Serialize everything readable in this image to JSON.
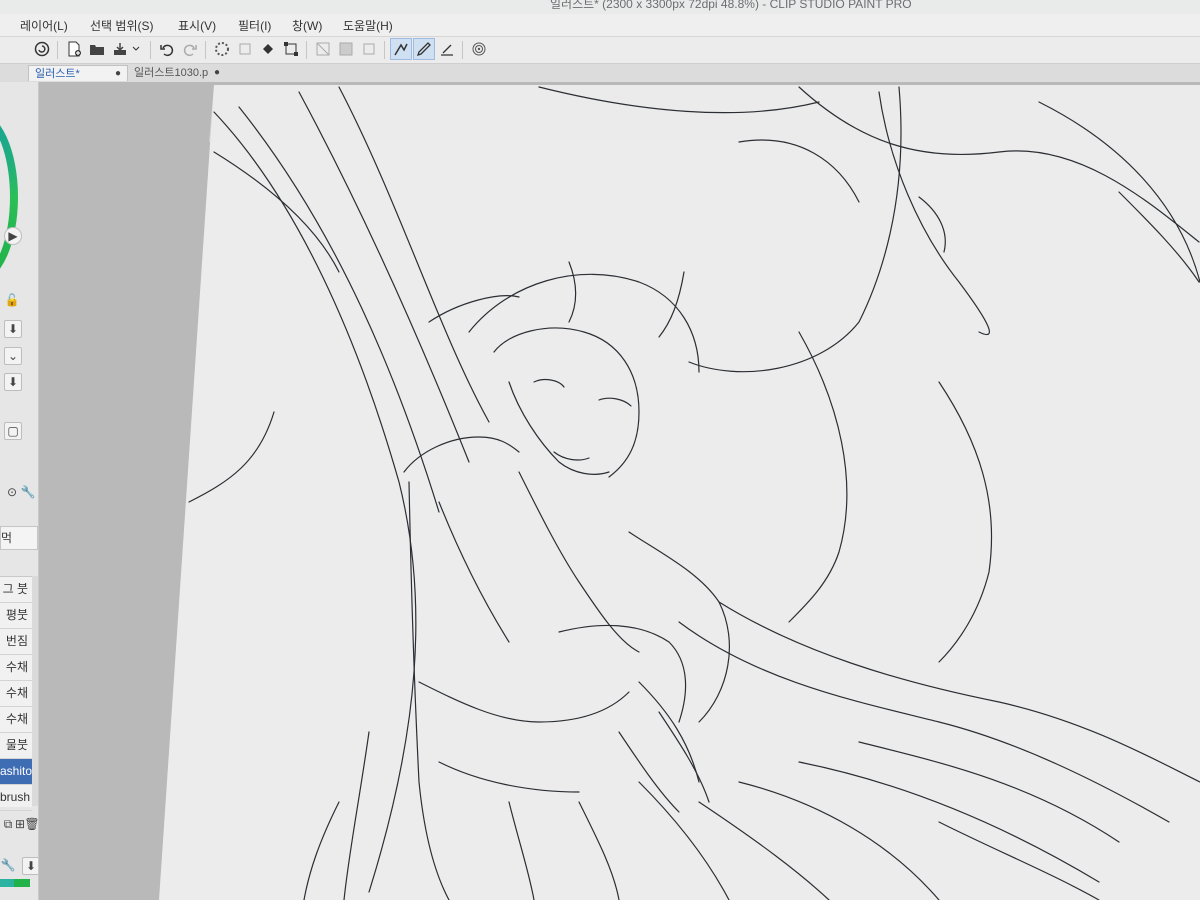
{
  "window": {
    "title": "일러스트* (2300 x 3300px 72dpi 48.8%)  - CLIP STUDIO PAINT PRO"
  },
  "menu": [
    {
      "label": "레이어(L)"
    },
    {
      "label": "선택 범위(S)"
    },
    {
      "label": "표시(V)"
    },
    {
      "label": "필터(I)"
    },
    {
      "label": "창(W)"
    },
    {
      "label": "도움말(H)"
    }
  ],
  "tabs": [
    {
      "label": "일러스트*",
      "marker": "●"
    },
    {
      "label": "일러스트1030.p",
      "marker": "●"
    }
  ],
  "brushes": [
    {
      "label": "그 붓"
    },
    {
      "label": "평붓"
    },
    {
      "label": "번짐"
    },
    {
      "label": "수채"
    },
    {
      "label": "수채"
    },
    {
      "label": "수채"
    },
    {
      "label": "물붓"
    },
    {
      "label": "ashito"
    },
    {
      "label": "brush"
    }
  ],
  "left_panel": {
    "ink_label": "먹"
  },
  "toolbar_icons": [
    "clip-studio-logo-icon",
    "new-file-icon",
    "open-folder-icon",
    "save-icon",
    "undo-icon",
    "redo-icon",
    "loading-icon",
    "fill-icon",
    "select-icon",
    "transform-icon",
    "stabilize-icon",
    "pen-icon",
    "pen-pressure-icon",
    "pen-line-icon",
    "spiral-icon"
  ],
  "colors": {
    "accent": "#3e6db3",
    "wheel_green": "#21b24a"
  }
}
